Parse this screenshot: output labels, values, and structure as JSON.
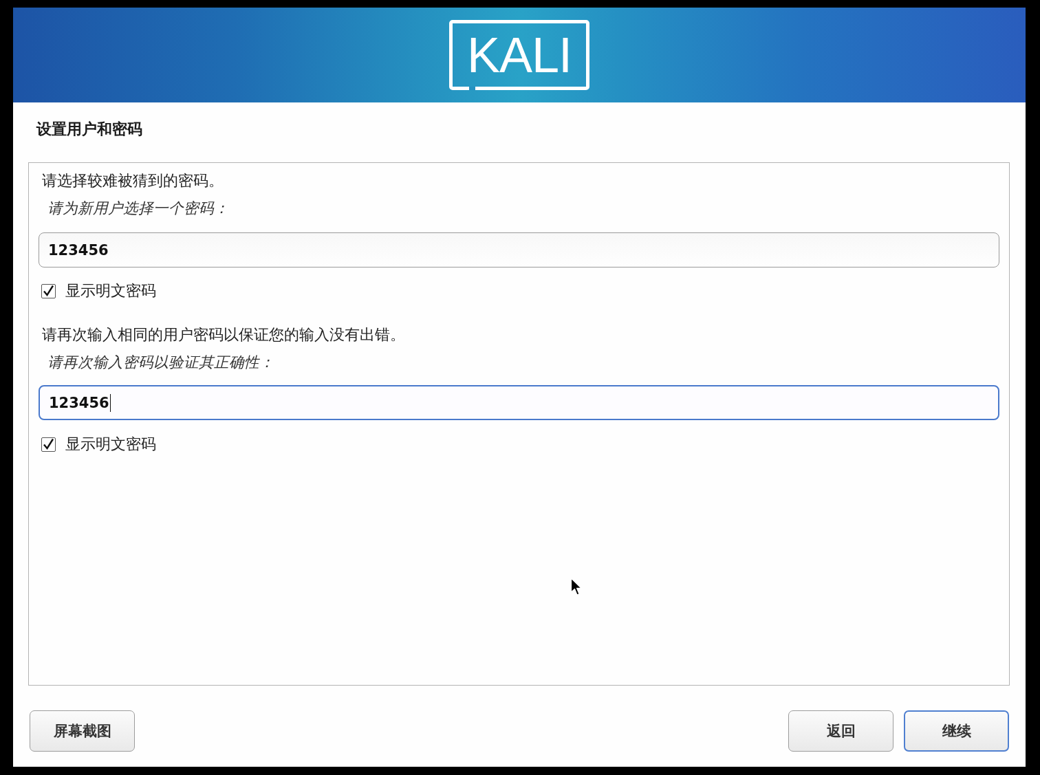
{
  "header": {
    "logo": "KALI"
  },
  "title": "设置用户和密码",
  "sections": [
    {
      "instruction": "请选择较难被猜到的密码。",
      "label": "请为新用户选择一个密码：",
      "field": {
        "value": "123456",
        "focused": false
      },
      "checkbox": {
        "label": "显示明文密码",
        "checked": true
      }
    },
    {
      "instruction": "请再次输入相同的用户密码以保证您的输入没有出错。",
      "label": "请再次输入密码以验证其正确性：",
      "field": {
        "value": "123456",
        "focused": true
      },
      "checkbox": {
        "label": "显示明文密码",
        "checked": true
      }
    }
  ],
  "footer": {
    "left_buttons": [
      {
        "label": "屏幕截图",
        "default": false
      }
    ],
    "right_buttons": [
      {
        "label": "返回",
        "default": false
      },
      {
        "label": "继续",
        "default": true
      }
    ]
  }
}
